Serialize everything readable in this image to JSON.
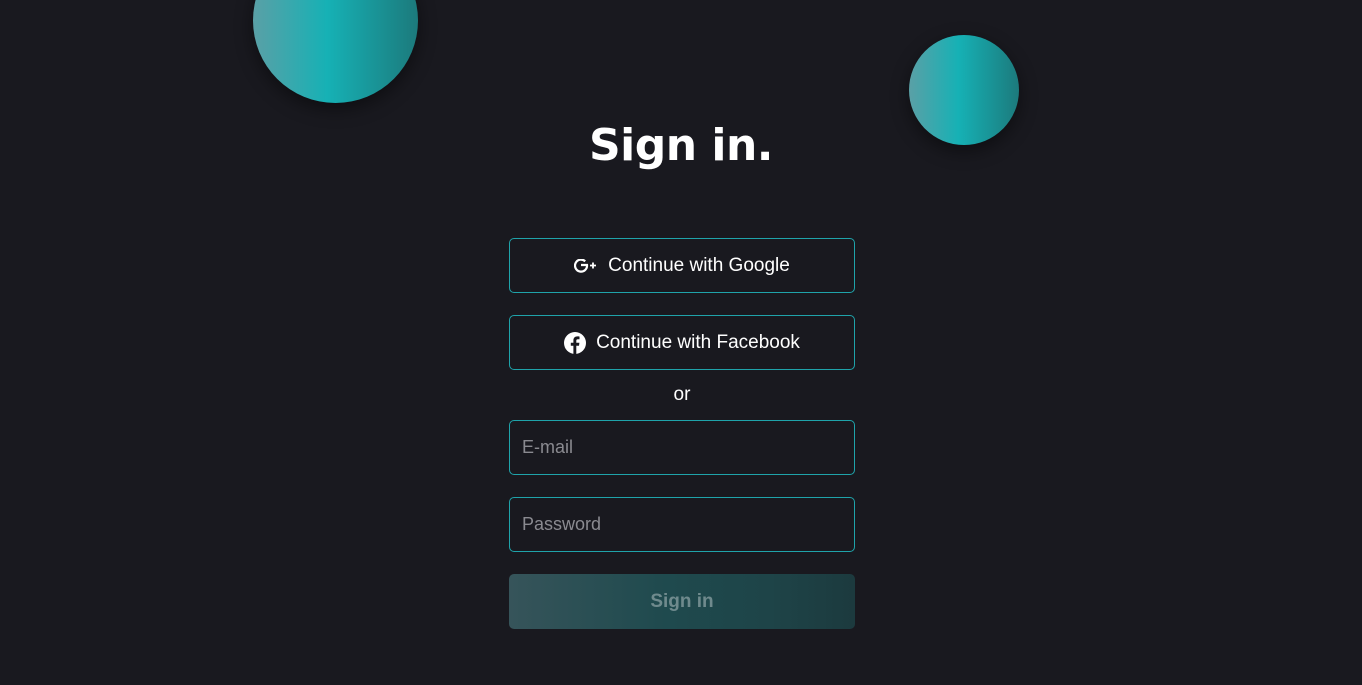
{
  "page": {
    "title": "Sign in."
  },
  "auth": {
    "google_label": "Continue with Google",
    "facebook_label": "Continue with Facebook",
    "divider_text": "or",
    "email_placeholder": "E-mail",
    "email_value": "",
    "password_placeholder": "Password",
    "password_value": "",
    "submit_label": "Sign in"
  },
  "icons": {
    "google": "google-plus-icon",
    "facebook": "facebook-icon"
  },
  "colors": {
    "background": "#19191f",
    "accent": "#1fa3aa",
    "orb_gradient": [
      "#5aa0a6",
      "#16b1b5",
      "#1c7a7c"
    ],
    "submit_disabled_text": "#6f8a8d"
  }
}
